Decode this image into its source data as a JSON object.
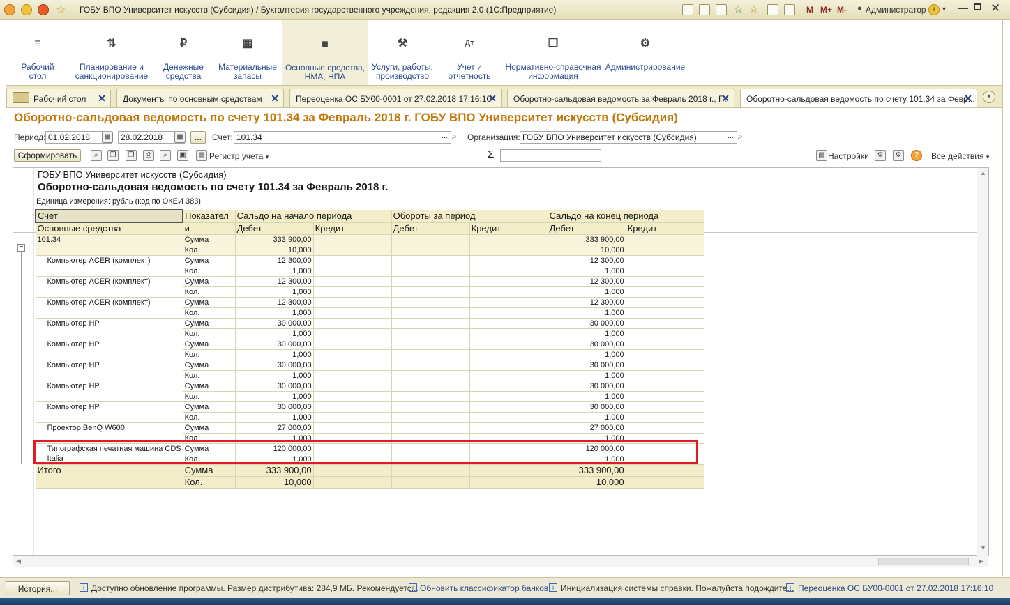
{
  "window": {
    "title": "ГОБУ ВПО Университет искусств (Субсидия) / Бухгалтерия государственного учреждения, редакция 2.0  (1С:Предприятие)",
    "memory_buttons": [
      "M",
      "M+",
      "M-"
    ],
    "user": "Администратор"
  },
  "sections": [
    {
      "label": "Рабочий стол",
      "icon": "menu-icon"
    },
    {
      "label": "Планирование и санкционирование",
      "icon": "planning-icon"
    },
    {
      "label": "Денежные средства",
      "icon": "ruble-icon"
    },
    {
      "label": "Материальные запасы",
      "icon": "grid-icon"
    },
    {
      "label": "Основные средства, НМА, НПА",
      "icon": "truck-icon"
    },
    {
      "label": "Услуги, работы, производство",
      "icon": "tools-icon"
    },
    {
      "label": "Учет и отчетность",
      "icon": "ledger-icon"
    },
    {
      "label": "Нормативно-справочная информация",
      "icon": "reference-icon"
    },
    {
      "label": "Администрирование",
      "icon": "gear-icon"
    }
  ],
  "tabs": [
    {
      "label": "Рабочий стол"
    },
    {
      "label": "Документы по основным средствам"
    },
    {
      "label": "Переоценка ОС БУ00-0001 от 27.02.2018 17:16:10"
    },
    {
      "label": "Оборотно-сальдовая ведомость за Февраль 2018 г., Г..."
    },
    {
      "label": "Оборотно-сальдовая ведомость по счету 101.34 за Февр..."
    }
  ],
  "report_title": "Оборотно-сальдовая ведомость по счету 101.34 за Февраль 2018 г. ГОБУ ВПО Университет искусств (Субсидия)",
  "filters": {
    "period_label": "Период:",
    "date_from": "01.02.2018",
    "date_to": "28.02.2018",
    "dots": "...",
    "account_label": "Счет:",
    "account": "101.34",
    "org_label": "Организация:",
    "org": "ГОБУ ВПО Университет искусств (Субсидия)"
  },
  "toolbar": {
    "generate": "Сформировать",
    "register": "Регистр учета",
    "sigma": "Σ",
    "settings": "Настройки",
    "all_actions": "Все действия"
  },
  "report": {
    "org": "ГОБУ ВПО Университет искусств (Субсидия)",
    "title": "Оборотно-сальдовая ведомость по счету 101.34 за Февраль 2018 г.",
    "unit": "Единица измерения: рубль (код по ОКЕИ 383)",
    "headers": {
      "account": "Счет",
      "fixed_assets": "Основные средства",
      "indicator1": "Показател",
      "indicator2": "и",
      "opening": "Сальдо на начало периода",
      "turnover": "Обороты за период",
      "closing": "Сальдо на конец периода",
      "debit": "Дебет",
      "credit": "Кредит"
    },
    "rows": [
      {
        "name": "101.34",
        "sum": "333 900,00",
        "qty": "10,000",
        "kind": "top"
      },
      {
        "name": "Компьютер ACER (комплект)",
        "sum": "12 300,00",
        "qty": "1,000",
        "kind": "item"
      },
      {
        "name": "Компьютер ACER (комплект)",
        "sum": "12 300,00",
        "qty": "1,000",
        "kind": "item"
      },
      {
        "name": "Компьютер ACER (комплект)",
        "sum": "12 300,00",
        "qty": "1,000",
        "kind": "item"
      },
      {
        "name": "Компьютер HP",
        "sum": "30 000,00",
        "qty": "1,000",
        "kind": "item"
      },
      {
        "name": "Компьютер HP",
        "sum": "30 000,00",
        "qty": "1,000",
        "kind": "item"
      },
      {
        "name": "Компьютер HP",
        "sum": "30 000,00",
        "qty": "1,000",
        "kind": "item"
      },
      {
        "name": "Компьютер HP",
        "sum": "30 000,00",
        "qty": "1,000",
        "kind": "item"
      },
      {
        "name": "Компьютер HP",
        "sum": "30 000,00",
        "qty": "1,000",
        "kind": "item"
      },
      {
        "name": "Проектор BenQ W600",
        "sum": "27 000,00",
        "qty": "1,000",
        "kind": "item"
      },
      {
        "name": "Типографская печатная машина CDS",
        "name2": "Italia",
        "sum": "120 000,00",
        "qty": "1,000",
        "kind": "item"
      }
    ],
    "total": {
      "label": "Итого",
      "sum": "333 900,00",
      "qty": "10,000"
    },
    "ind_sum": "Сумма",
    "ind_qty": "Кол."
  },
  "statusbar": {
    "history": "История...",
    "items": [
      "Доступно обновление программы. Размер дистрибутива: 284,9 МБ. Рекомендуетс...",
      "Обновить классификатор банков",
      "Инициализация системы справки. Пожалуйста подождите...",
      "Переоценка ОС БУ00-0001 от 27.02.2018 17:16:10"
    ]
  },
  "colors": {
    "accent_title": "#c0780a",
    "highlight": "#e01b24",
    "link": "#2b4a8a"
  }
}
